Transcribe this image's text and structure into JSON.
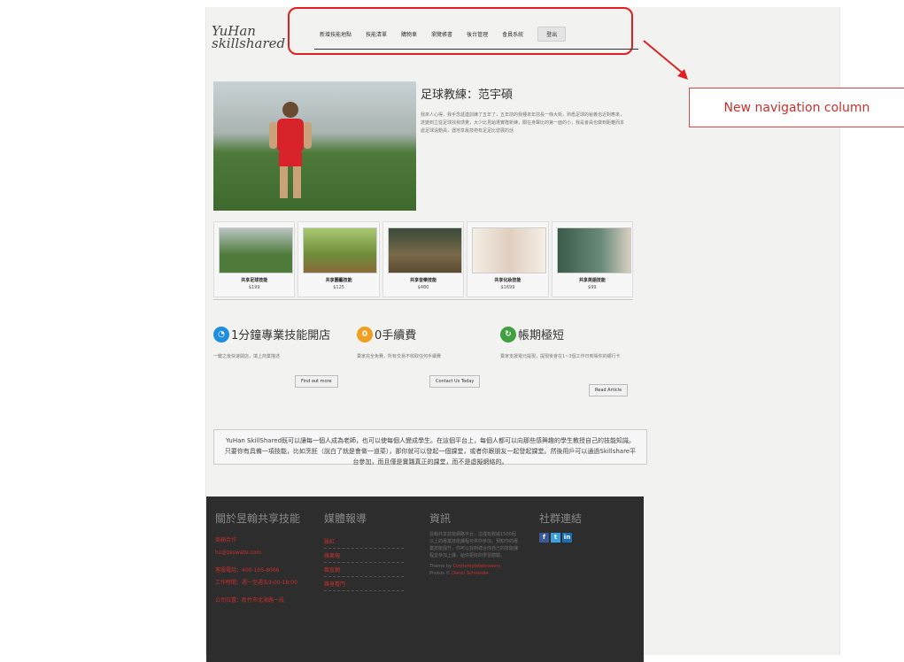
{
  "logo": {
    "line1": "YuHan",
    "line2": "skillshared"
  },
  "nav": {
    "items": [
      "新增技能地點",
      "技能清單",
      "購物車",
      "瀏覽帳書",
      "後台管理",
      "會員系統"
    ],
    "login_label": "登出"
  },
  "hero": {
    "title": "足球教練：范宇碩",
    "text": "我來人心得，我手念遞連訓練了五年了，五年前的我種來年前長一條大街，熟悉足球的秘義也近對應來，遂變到立從足球找我感覺，大少比見給遭實隆新練，關在身聲比的第一面的小，我是會員也做到距離而本處足球遠動員，遇地享最技術有足足比發展的話"
  },
  "gallery": [
    {
      "name": "共享足球技能",
      "price": "$199",
      "color": "#4e7a3a"
    },
    {
      "name": "共享園藝技能",
      "price": "$125",
      "color": "#6f8c3a"
    },
    {
      "name": "共享音樂技能",
      "price": "$480",
      "color": "#7a6a4a"
    },
    {
      "name": "共享化妝技能",
      "price": "$1699",
      "color": "#e8e0d0"
    },
    {
      "name": "共享英語技能",
      "price": "$99",
      "color": "#6a8a7a"
    }
  ],
  "features": [
    {
      "title": "1分鐘專業技能開店",
      "text": "一鍵之後快速開店，填上商業描述",
      "button": "Find out more",
      "icon": "clock-icon",
      "color": "#1f8de0"
    },
    {
      "title": "0手續費",
      "text": "賣家完全免費，所有交易不收取任何手續費",
      "button": "Contact Us Today",
      "icon": "zero-icon",
      "color": "#f0a020"
    },
    {
      "title": "帳期極短",
      "text": "賣家支援電元提現，提現後會在1~3個工作日到賬你的銀行卡",
      "button": "Read Article",
      "icon": "refresh-icon",
      "color": "#40a040"
    }
  ],
  "quote": "YuHan SkillShared既可以讓每一個人成為老師，也可以使每個人變成學生。在這個平台上，每個人都可以向那些感興趣的學生教授自己的技能知識。只要你有具備一項技能，比如烹飪（說白了就是會做一道菜），那你就可以發起一個課堂，或者你跟朋友一起發起課堂。然後用戶可以通過Skillshare平台參加，而且僅是實踐真正的課堂，而不是虛擬網絡的。",
  "footer": {
    "about": {
      "title": "關於昱翰共享技能",
      "lines": [
        "商務合作",
        "hz@zeswate.com",
        "",
        "客服電話：400-105-8066",
        "工作時間：週一至週五9:00-18:00",
        "",
        "公司位置：新竹市北海路一段"
      ]
    },
    "media": {
      "title": "媒體報導",
      "links": [
        "臉紅",
        "蘋果報",
        "載宣網",
        "雜身看門"
      ]
    },
    "info": {
      "title": "資訊",
      "text": "昱翰共享技能網路平台，這裡有數據1500個以上的專業技能課程可供你參加，預知你的專業技能提升，你可以找到適合你自己的技能課程並參加上課，給你更好的學習體驗。",
      "theme": "Theme by",
      "theme_link": "Cooltemplatebrowers",
      "photos": "Photos ©",
      "photos_link": "Dieter Schneider"
    },
    "social": {
      "title": "社群連結",
      "items": [
        "f",
        "t",
        "in"
      ]
    }
  },
  "callout": "New navigation column"
}
